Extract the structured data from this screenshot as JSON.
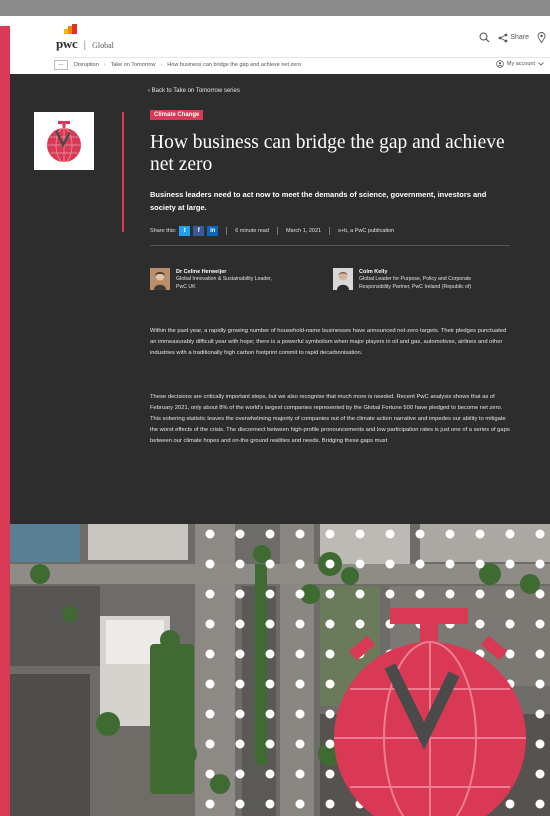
{
  "header": {
    "logo_text": "pwc",
    "logo_region": "Global",
    "share_label": "Share",
    "account_label": "My account"
  },
  "breadcrumb": {
    "more": "...",
    "items": [
      "Disruption",
      "Take on Tomorrow",
      "How business can bridge the gap and achieve net zero"
    ]
  },
  "article": {
    "back_link": "Back to Take on Tomorrow series",
    "tag": "Climate Change",
    "title": "How business can bridge the gap and achieve net zero",
    "subtitle": "Business leaders need to act now to meet the demands of science, government, investors and society at large.",
    "share_label": "Share this:",
    "read_time": "6 minute read",
    "date": "March 1, 2021",
    "publication": "s+b, a PwC publication",
    "authors": [
      {
        "name": "Dr Celine Herweijer",
        "role": "Global Innovation & Sustainability Leader, PwC UK"
      },
      {
        "name": "Colm Kelly",
        "role": "Global Leader for Purpose, Policy and Corporate Responsibility Partner, PwC Ireland (Republic of)"
      }
    ],
    "paragraphs": [
      "Within the past year, a rapidly growing number of household-name businesses have announced net-zero targets. Their pledges punctuated an immeasurably difficult year with hope; there is a powerful symbolism when major players in oil and gas, automotives, airlines and other industries with a traditionally high carbon footprint commit to rapid decarbonisation.",
      "These decisions are critically important steps, but we also recognise that much more is needed. Recent PwC analysis shows that as of February 2021, only about 8% of the world's largest companies represented by the Global Fortune 500 have pledged to become net zero. This sobering statistic leaves the overwhelming majority of companies out of the climate action narrative and impedes our ability to mitigate the worst effects of the crisis. The disconnect between high-profile pronouncements and low participation rates is just one of a series of gaps between our climate hopes and on-the ground realities and needs. Bridging these gaps must"
    ]
  },
  "colors": {
    "accent": "#d93954",
    "dark_panel": "#2d2d2d",
    "logo_orange": "#e0301e",
    "linkedin": "#0a66c2",
    "twitter": "#1da1f2",
    "facebook": "#3b5998"
  },
  "icons": [
    "pwc-logo-icon",
    "search-icon",
    "share-icon",
    "location-icon",
    "more-icon",
    "account-icon",
    "chevron-down-icon",
    "back-chevron-icon",
    "twitter-icon",
    "facebook-icon",
    "linkedin-icon",
    "stopwatch-globe-icon"
  ]
}
